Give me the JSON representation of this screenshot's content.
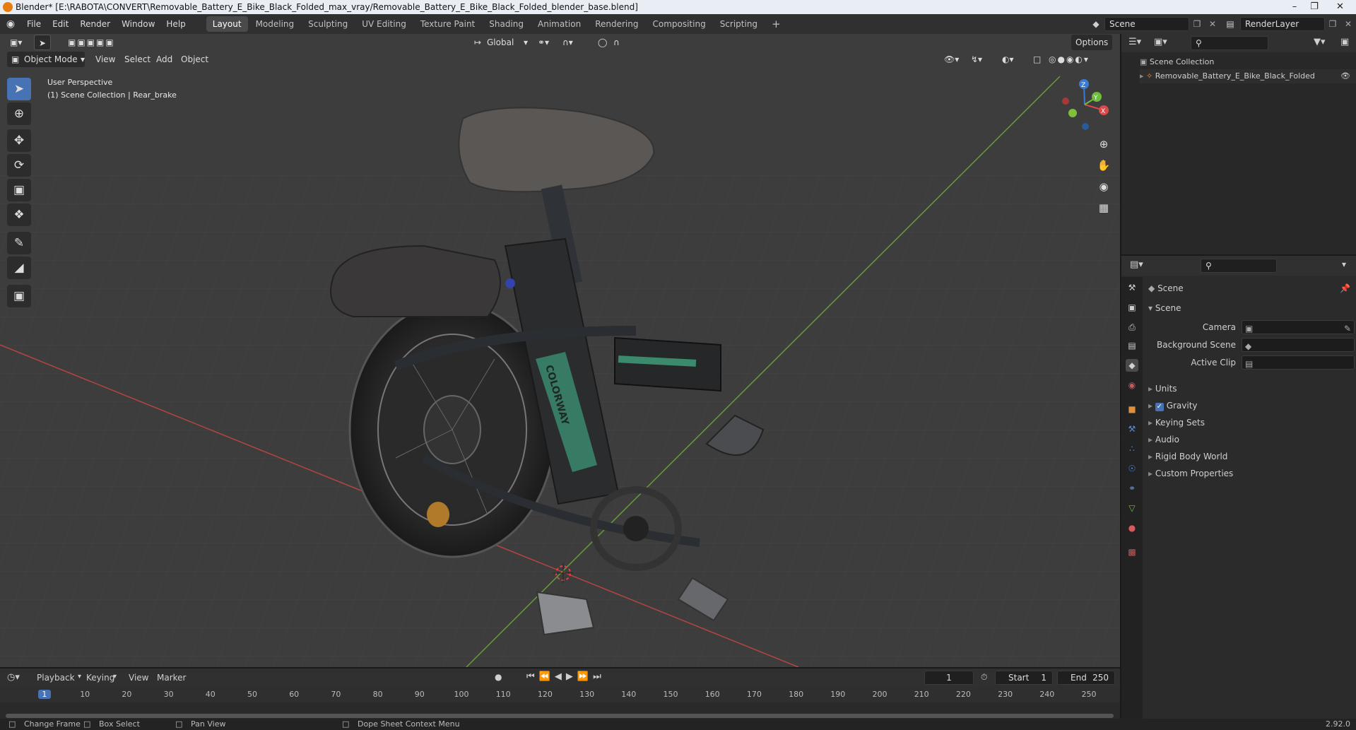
{
  "window": {
    "title": "Blender* [E:\\RABOTA\\CONVERT\\Removable_Battery_E_Bike_Black_Folded_max_vray/Removable_Battery_E_Bike_Black_Folded_blender_base.blend]"
  },
  "menu": [
    "File",
    "Edit",
    "Render",
    "Window",
    "Help"
  ],
  "workspaces": [
    "Layout",
    "Modeling",
    "Sculpting",
    "UV Editing",
    "Texture Paint",
    "Shading",
    "Animation",
    "Rendering",
    "Compositing",
    "Scripting"
  ],
  "scene_field": "Scene",
  "renderlayer_field": "RenderLayer",
  "viewport": {
    "mode": "Object Mode",
    "header_menus": [
      "View",
      "Select",
      "Add",
      "Object"
    ],
    "transform_orientation": "Global",
    "options_label": "Options",
    "overlay_line1": "User Perspective",
    "overlay_line2": "(1) Scene Collection | Rear_brake",
    "gizmo_x": "X",
    "gizmo_y": "Y",
    "gizmo_z": "Z",
    "frame_brand": "COLORWAY"
  },
  "outliner": {
    "root": "Scene Collection",
    "items": [
      "Removable_Battery_E_Bike_Black_Folded"
    ]
  },
  "properties": {
    "header": "Scene",
    "panel": "Scene",
    "fields": [
      {
        "label": "Camera"
      },
      {
        "label": "Background Scene"
      },
      {
        "label": "Active Clip"
      }
    ],
    "subpanels": [
      "Units",
      "Gravity",
      "Keying Sets",
      "Audio",
      "Rigid Body World",
      "Custom Properties"
    ],
    "gravity_checked": true
  },
  "timeline": {
    "menus": [
      "Playback",
      "Keying",
      "View",
      "Marker"
    ],
    "current_frame": "1",
    "start_label": "Start",
    "start_value": "1",
    "end_label": "End",
    "end_value": "250",
    "ruler": [
      "1",
      "10",
      "20",
      "30",
      "40",
      "50",
      "60",
      "70",
      "80",
      "90",
      "100",
      "110",
      "120",
      "130",
      "140",
      "150",
      "160",
      "170",
      "180",
      "190",
      "200",
      "210",
      "220",
      "230",
      "240",
      "250"
    ]
  },
  "statusbar": {
    "items": [
      "Change Frame",
      "Box Select",
      "Pan View",
      "Dope Sheet Context Menu"
    ],
    "version": "2.92.0"
  }
}
